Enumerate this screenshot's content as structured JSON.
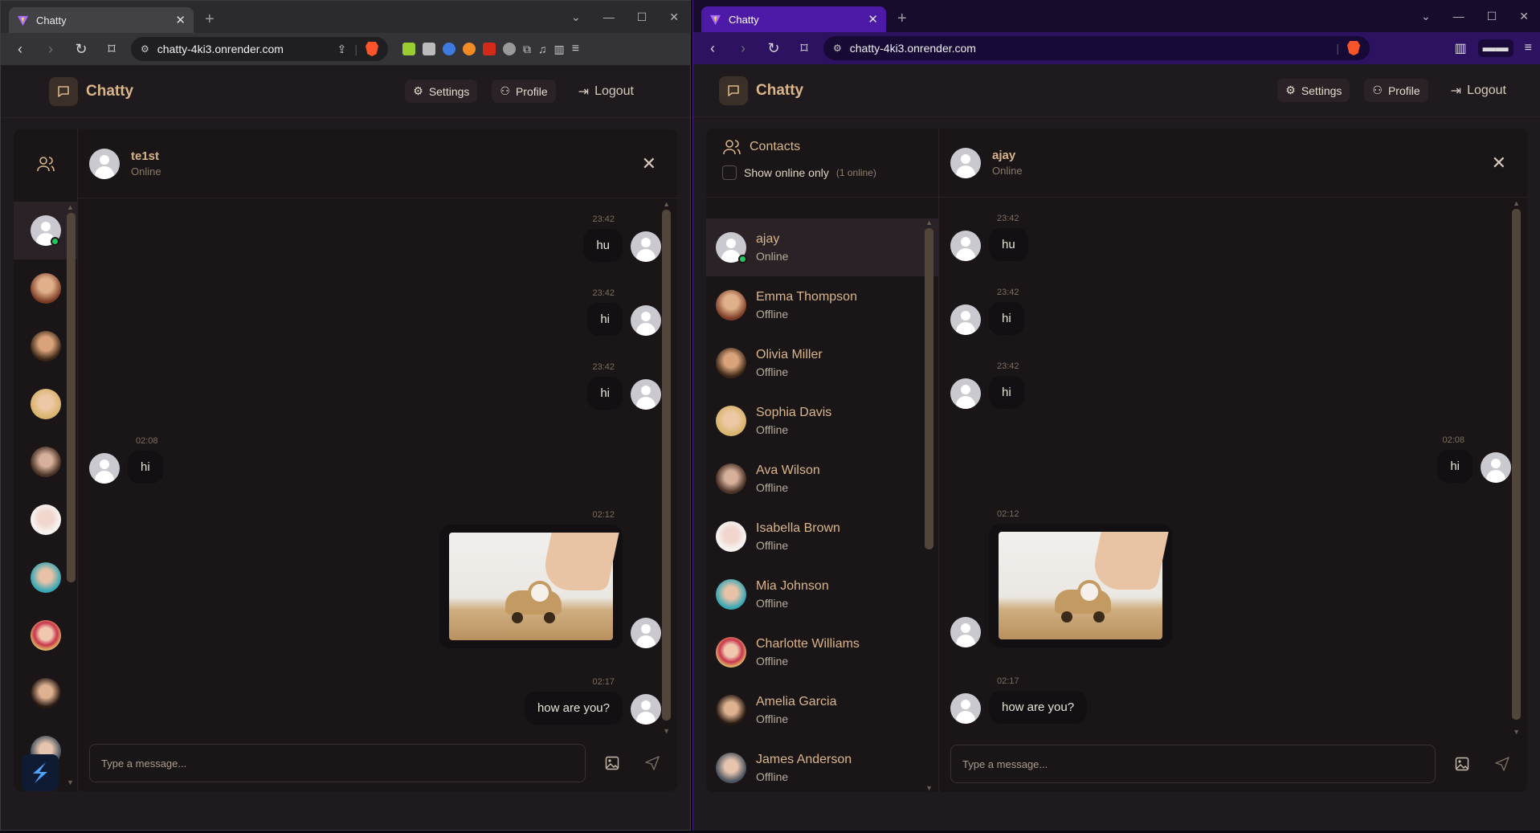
{
  "browser": {
    "tab_title": "Chatty",
    "url": "chatty-4ki3.onrender.com"
  },
  "app": {
    "brand": "Chatty",
    "nav": {
      "settings": "Settings",
      "profile": "Profile",
      "logout": "Logout"
    },
    "composer_placeholder": "Type a message..."
  },
  "left_window": {
    "chat": {
      "name": "te1st",
      "status": "Online"
    },
    "messages": [
      {
        "time": "23:42",
        "text": "hu",
        "side": "right"
      },
      {
        "time": "23:42",
        "text": "hi",
        "side": "right"
      },
      {
        "time": "23:42",
        "text": "hi",
        "side": "right"
      },
      {
        "time": "02:08",
        "text": "hi",
        "side": "left"
      },
      {
        "time": "02:12",
        "text": "",
        "side": "right",
        "image": true
      },
      {
        "time": "02:17",
        "text": "how are you?",
        "side": "right"
      }
    ]
  },
  "right_window": {
    "contacts_title": "Contacts",
    "online_toggle": "Show online only",
    "online_count": "(1 online)",
    "contacts": [
      {
        "name": "ajay",
        "status": "Online"
      },
      {
        "name": "Emma Thompson",
        "status": "Offline"
      },
      {
        "name": "Olivia Miller",
        "status": "Offline"
      },
      {
        "name": "Sophia Davis",
        "status": "Offline"
      },
      {
        "name": "Ava Wilson",
        "status": "Offline"
      },
      {
        "name": "Isabella Brown",
        "status": "Offline"
      },
      {
        "name": "Mia Johnson",
        "status": "Offline"
      },
      {
        "name": "Charlotte Williams",
        "status": "Offline"
      },
      {
        "name": "Amelia Garcia",
        "status": "Offline"
      },
      {
        "name": "James Anderson",
        "status": "Offline"
      }
    ],
    "chat": {
      "name": "ajay",
      "status": "Online"
    },
    "messages": [
      {
        "time": "23:42",
        "text": "hu",
        "side": "left"
      },
      {
        "time": "23:42",
        "text": "hi",
        "side": "left"
      },
      {
        "time": "23:42",
        "text": "hi",
        "side": "left"
      },
      {
        "time": "02:08",
        "text": "hi",
        "side": "right"
      },
      {
        "time": "02:12",
        "text": "",
        "side": "left",
        "image": true
      },
      {
        "time": "02:17",
        "text": "how are you?",
        "side": "left"
      }
    ]
  },
  "colors": {
    "accent": "#d9b589",
    "online": "#22c55e",
    "brave_tab": "#4c1aa6"
  }
}
